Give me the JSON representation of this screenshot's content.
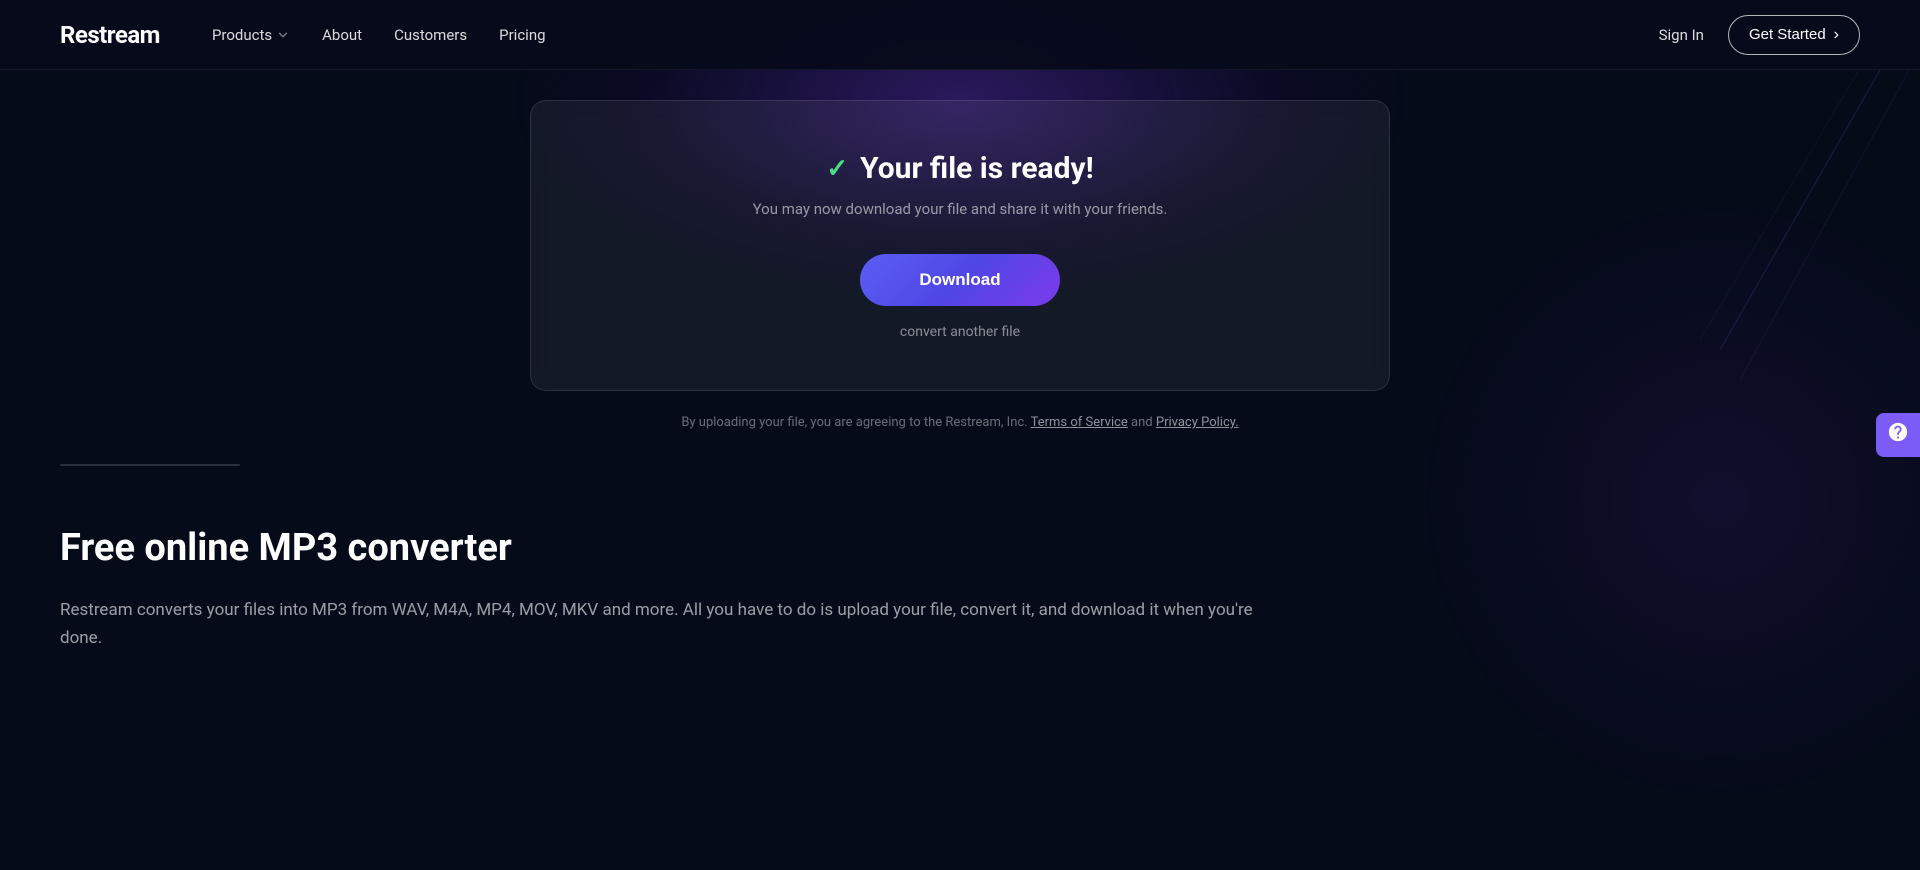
{
  "brand": {
    "logo": "Restream"
  },
  "nav": {
    "products_label": "Products",
    "about_label": "About",
    "customers_label": "Customers",
    "pricing_label": "Pricing",
    "sign_in_label": "Sign In",
    "get_started_label": "Get Started"
  },
  "card": {
    "title": "Your file is ready!",
    "subtitle": "You may now download your file and share it with your friends.",
    "download_label": "Download",
    "convert_another_label": "convert another file"
  },
  "terms": {
    "prefix": "By uploading your file, you are agreeing to the Restream, Inc.",
    "tos_label": "Terms of Service",
    "middle": "and",
    "privacy_label": "Privacy Policy."
  },
  "info": {
    "title": "Free online MP3 converter",
    "description": "Restream converts your files into MP3 from WAV, M4A, MP4, MOV, MKV and more. All you have to do is upload your file, convert it, and download it when you're done."
  },
  "colors": {
    "accent_purple": "#7c5cf6",
    "download_gradient_start": "#5b5ef4",
    "download_gradient_end": "#7c3aed",
    "checkmark": "#4ade80",
    "background": "#060b1a"
  }
}
